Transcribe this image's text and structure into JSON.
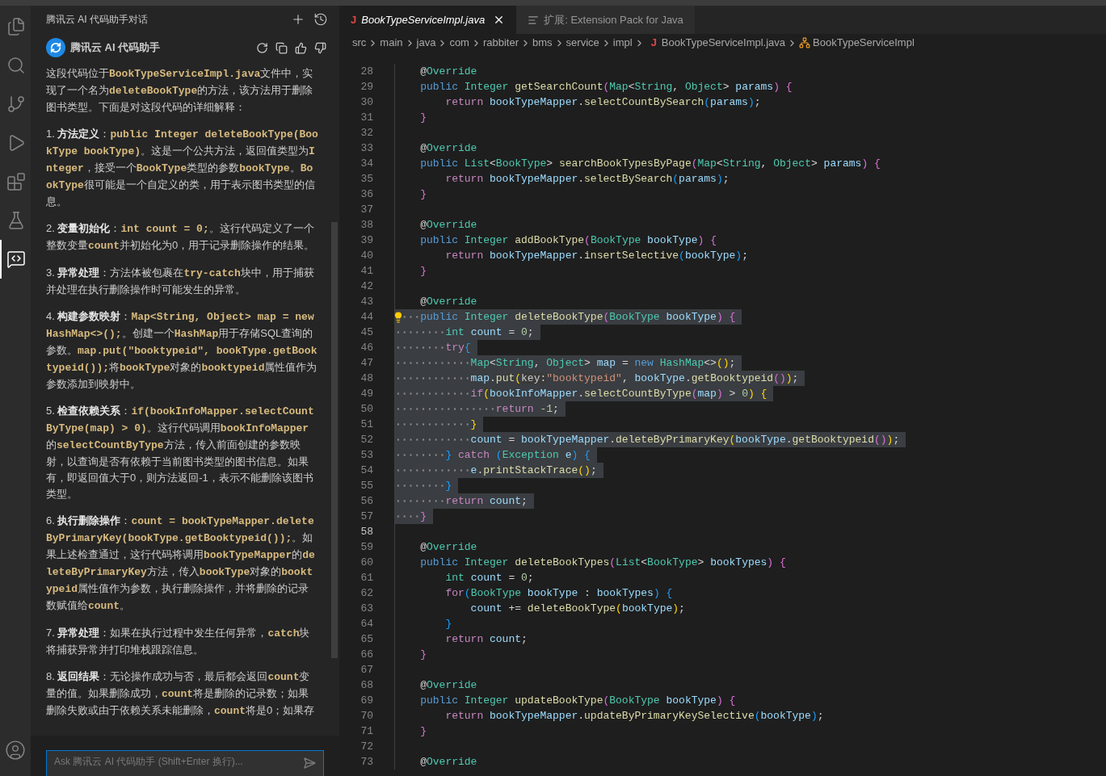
{
  "activity_bar": {
    "items": [
      {
        "kind": "files",
        "selected": false
      },
      {
        "kind": "search",
        "selected": false
      },
      {
        "kind": "source-control",
        "selected": false
      },
      {
        "kind": "run",
        "selected": false
      },
      {
        "kind": "extensions",
        "selected": false
      },
      {
        "kind": "testing",
        "selected": false
      },
      {
        "kind": "chat",
        "selected": true
      }
    ],
    "account": {
      "kind": "account"
    }
  },
  "sidebar": {
    "title": "腾讯云 AI 代码助手对话",
    "assistant": {
      "name": "腾讯云 AI 代码助手"
    },
    "paragraphs": [
      [
        {
          "kind": "text",
          "text": "这段代码位于"
        },
        {
          "kind": "code",
          "text": "BookTypeServiceImpl.java"
        },
        {
          "kind": "text",
          "text": "文件中，实现了一个名为"
        },
        {
          "kind": "code",
          "text": "deleteBookType"
        },
        {
          "kind": "text",
          "text": "的方法，该方法用于删除图书类型。下面是对这段代码的详细解释："
        }
      ],
      [
        {
          "kind": "text",
          "text": "1. "
        },
        {
          "kind": "bold",
          "text": "方法定义"
        },
        {
          "kind": "text",
          "text": "："
        },
        {
          "kind": "code",
          "text": "public Integer deleteBookType(BookType bookType)"
        },
        {
          "kind": "text",
          "text": "。这是一个公共方法，返回值类型为"
        },
        {
          "kind": "code",
          "text": "Integer"
        },
        {
          "kind": "text",
          "text": "，接受一个"
        },
        {
          "kind": "code",
          "text": "BookType"
        },
        {
          "kind": "text",
          "text": "类型的参数"
        },
        {
          "kind": "code",
          "text": "bookType"
        },
        {
          "kind": "text",
          "text": "。"
        },
        {
          "kind": "code",
          "text": "BookType"
        },
        {
          "kind": "text",
          "text": "很可能是一个自定义的类，用于表示图书类型的信息。"
        }
      ],
      [
        {
          "kind": "text",
          "text": "2. "
        },
        {
          "kind": "bold",
          "text": "变量初始化"
        },
        {
          "kind": "text",
          "text": "："
        },
        {
          "kind": "code",
          "text": "int count = 0;"
        },
        {
          "kind": "text",
          "text": "。这行代码定义了一个整数变量"
        },
        {
          "kind": "code",
          "text": "count"
        },
        {
          "kind": "text",
          "text": "并初始化为0，用于记录删除操作的结果。"
        }
      ],
      [
        {
          "kind": "text",
          "text": "3. "
        },
        {
          "kind": "bold",
          "text": "异常处理"
        },
        {
          "kind": "text",
          "text": "：方法体被包裹在"
        },
        {
          "kind": "code",
          "text": "try-catch"
        },
        {
          "kind": "text",
          "text": "块中，用于捕获并处理在执行删除操作时可能发生的异常。"
        }
      ],
      [
        {
          "kind": "text",
          "text": "4. "
        },
        {
          "kind": "bold",
          "text": "构建参数映射"
        },
        {
          "kind": "text",
          "text": "："
        },
        {
          "kind": "code",
          "text": "Map<String, Object> map = new HashMap<>();"
        },
        {
          "kind": "text",
          "text": "。创建一个"
        },
        {
          "kind": "code",
          "text": "HashMap"
        },
        {
          "kind": "text",
          "text": "用于存储SQL查询的参数。"
        },
        {
          "kind": "code",
          "text": "map.put(\"booktypeid\", bookType.getBooktypeid());"
        },
        {
          "kind": "text",
          "text": "将"
        },
        {
          "kind": "code",
          "text": "bookType"
        },
        {
          "kind": "text",
          "text": "对象的"
        },
        {
          "kind": "code",
          "text": "booktypeid"
        },
        {
          "kind": "text",
          "text": "属性值作为参数添加到映射中。"
        }
      ],
      [
        {
          "kind": "text",
          "text": "5. "
        },
        {
          "kind": "bold",
          "text": "检查依赖关系"
        },
        {
          "kind": "text",
          "text": "："
        },
        {
          "kind": "code",
          "text": "if(bookInfoMapper.selectCountByType(map) > 0)"
        },
        {
          "kind": "text",
          "text": "。这行代码调用"
        },
        {
          "kind": "code",
          "text": "bookInfoMapper"
        },
        {
          "kind": "text",
          "text": "的"
        },
        {
          "kind": "code",
          "text": "selectCountByType"
        },
        {
          "kind": "text",
          "text": "方法，传入前面创建的参数映射，以查询是否有依赖于当前图书类型的图书信息。如果有，即返回值大于0，则方法返回-1，表示不能删除该图书类型。"
        }
      ],
      [
        {
          "kind": "text",
          "text": "6. "
        },
        {
          "kind": "bold",
          "text": "执行删除操作"
        },
        {
          "kind": "text",
          "text": "："
        },
        {
          "kind": "code",
          "text": "count = bookTypeMapper.deleteByPrimaryKey(bookType.getBooktypeid());"
        },
        {
          "kind": "text",
          "text": "。如果上述检查通过，这行代码将调用"
        },
        {
          "kind": "code",
          "text": "bookTypeMapper"
        },
        {
          "kind": "text",
          "text": "的"
        },
        {
          "kind": "code",
          "text": "deleteByPrimaryKey"
        },
        {
          "kind": "text",
          "text": "方法，传入"
        },
        {
          "kind": "code",
          "text": "bookType"
        },
        {
          "kind": "text",
          "text": "对象的"
        },
        {
          "kind": "code",
          "text": "booktypeid"
        },
        {
          "kind": "text",
          "text": "属性值作为参数，执行删除操作，并将删除的记录数赋值给"
        },
        {
          "kind": "code",
          "text": "count"
        },
        {
          "kind": "text",
          "text": "。"
        }
      ],
      [
        {
          "kind": "text",
          "text": "7. "
        },
        {
          "kind": "bold",
          "text": "异常处理"
        },
        {
          "kind": "text",
          "text": "：如果在执行过程中发生任何异常，"
        },
        {
          "kind": "code",
          "text": "catch"
        },
        {
          "kind": "text",
          "text": "块将捕获异常并打印堆栈跟踪信息。"
        }
      ],
      [
        {
          "kind": "text",
          "text": "8. "
        },
        {
          "kind": "bold",
          "text": "返回结果"
        },
        {
          "kind": "text",
          "text": "：无论操作成功与否，最后都会返回"
        },
        {
          "kind": "code",
          "text": "count"
        },
        {
          "kind": "text",
          "text": "变量的值。如果删除成功，"
        },
        {
          "kind": "code",
          "text": "count"
        },
        {
          "kind": "text",
          "text": "将是删除的记录数；如果删除失败或由于依赖关系未能删除，"
        },
        {
          "kind": "code",
          "text": "count"
        },
        {
          "kind": "text",
          "text": "将是0；如果存"
        }
      ]
    ],
    "input": {
      "placeholder": "Ask 腾讯云 AI 代码助手 (Shift+Enter 换行)..."
    }
  },
  "tabs": [
    {
      "file_icon": "J",
      "label": "BookTypeServiceImpl.java",
      "selected": true,
      "kind": "file"
    },
    {
      "label": "扩展: Extension Pack for Java",
      "selected": false,
      "kind": "extension"
    }
  ],
  "breadcrumbs": [
    {
      "kind": "folder",
      "text": "src"
    },
    {
      "kind": "folder",
      "text": "main"
    },
    {
      "kind": "folder",
      "text": "java"
    },
    {
      "kind": "folder",
      "text": "com"
    },
    {
      "kind": "folder",
      "text": "rabbiter"
    },
    {
      "kind": "folder",
      "text": "bms"
    },
    {
      "kind": "folder",
      "text": "service"
    },
    {
      "kind": "folder",
      "text": "impl"
    },
    {
      "kind": "java-file",
      "file_icon": "J",
      "text": "BookTypeServiceImpl.java"
    },
    {
      "kind": "class",
      "text": "BookTypeServiceImpl"
    }
  ],
  "editor": {
    "lines": [
      {
        "number": "28",
        "selected": false,
        "current": false,
        "lightbulb": false,
        "tokens": [
          {
            "kind": "p",
            "text": "    @"
          },
          {
            "kind": "type",
            "text": "Override"
          }
        ]
      },
      {
        "number": "29",
        "selected": false,
        "current": false,
        "lightbulb": false,
        "tokens": [
          {
            "kind": "kw",
            "text": "    public "
          },
          {
            "kind": "type",
            "text": "Integer "
          },
          {
            "kind": "fn",
            "text": "getSearchCount"
          },
          {
            "kind": "b2",
            "text": "("
          },
          {
            "kind": "type",
            "text": "Map"
          },
          {
            "kind": "p",
            "text": "<"
          },
          {
            "kind": "type",
            "text": "String"
          },
          {
            "kind": "p",
            "text": ", "
          },
          {
            "kind": "type",
            "text": "Object"
          },
          {
            "kind": "p",
            "text": "> "
          },
          {
            "kind": "var",
            "text": "params"
          },
          {
            "kind": "b2",
            "text": ")"
          },
          {
            "kind": "b2",
            "text": " {"
          }
        ]
      },
      {
        "number": "30",
        "selected": false,
        "current": false,
        "lightbulb": false,
        "tokens": [
          {
            "kind": "ctl",
            "text": "        return "
          },
          {
            "kind": "var",
            "text": "bookTypeMapper"
          },
          {
            "kind": "p",
            "text": "."
          },
          {
            "kind": "fn",
            "text": "selectCountBySearch"
          },
          {
            "kind": "b3",
            "text": "("
          },
          {
            "kind": "var",
            "text": "params"
          },
          {
            "kind": "b3",
            "text": ")"
          },
          {
            "kind": "p",
            "text": ";"
          }
        ]
      },
      {
        "number": "31",
        "selected": false,
        "current": false,
        "lightbulb": false,
        "tokens": [
          {
            "kind": "b2",
            "text": "    }"
          }
        ]
      },
      {
        "number": "32",
        "selected": false,
        "current": false,
        "lightbulb": false
      },
      {
        "number": "33",
        "selected": false,
        "current": false,
        "lightbulb": false,
        "tokens": [
          {
            "kind": "p",
            "text": "    @"
          },
          {
            "kind": "type",
            "text": "Override"
          }
        ]
      },
      {
        "number": "34",
        "selected": false,
        "current": false,
        "lightbulb": false,
        "tokens": [
          {
            "kind": "kw",
            "text": "    public "
          },
          {
            "kind": "type",
            "text": "List"
          },
          {
            "kind": "p",
            "text": "<"
          },
          {
            "kind": "type",
            "text": "BookType"
          },
          {
            "kind": "p",
            "text": "> "
          },
          {
            "kind": "fn",
            "text": "searchBookTypesByPage"
          },
          {
            "kind": "b2",
            "text": "("
          },
          {
            "kind": "type",
            "text": "Map"
          },
          {
            "kind": "p",
            "text": "<"
          },
          {
            "kind": "type",
            "text": "String"
          },
          {
            "kind": "p",
            "text": ", "
          },
          {
            "kind": "type",
            "text": "Object"
          },
          {
            "kind": "p",
            "text": "> "
          },
          {
            "kind": "var",
            "text": "params"
          },
          {
            "kind": "b2",
            "text": ")"
          },
          {
            "kind": "b2",
            "text": " {"
          }
        ]
      },
      {
        "number": "35",
        "selected": false,
        "current": false,
        "lightbulb": false,
        "tokens": [
          {
            "kind": "ctl",
            "text": "        return "
          },
          {
            "kind": "var",
            "text": "bookTypeMapper"
          },
          {
            "kind": "p",
            "text": "."
          },
          {
            "kind": "fn",
            "text": "selectBySearch"
          },
          {
            "kind": "b3",
            "text": "("
          },
          {
            "kind": "var",
            "text": "params"
          },
          {
            "kind": "b3",
            "text": ")"
          },
          {
            "kind": "p",
            "text": ";"
          }
        ]
      },
      {
        "number": "36",
        "selected": false,
        "current": false,
        "lightbulb": false,
        "tokens": [
          {
            "kind": "b2",
            "text": "    }"
          }
        ]
      },
      {
        "number": "37",
        "selected": false,
        "current": false,
        "lightbulb": false
      },
      {
        "number": "38",
        "selected": false,
        "current": false,
        "lightbulb": false,
        "tokens": [
          {
            "kind": "p",
            "text": "    @"
          },
          {
            "kind": "type",
            "text": "Override"
          }
        ]
      },
      {
        "number": "39",
        "selected": false,
        "current": false,
        "lightbulb": false,
        "tokens": [
          {
            "kind": "kw",
            "text": "    public "
          },
          {
            "kind": "type",
            "text": "Integer "
          },
          {
            "kind": "fn",
            "text": "addBookType"
          },
          {
            "kind": "b2",
            "text": "("
          },
          {
            "kind": "type",
            "text": "BookType "
          },
          {
            "kind": "var",
            "text": "bookType"
          },
          {
            "kind": "b2",
            "text": ")"
          },
          {
            "kind": "b2",
            "text": " {"
          }
        ]
      },
      {
        "number": "40",
        "selected": false,
        "current": false,
        "lightbulb": false,
        "tokens": [
          {
            "kind": "ctl",
            "text": "        return "
          },
          {
            "kind": "var",
            "text": "bookTypeMapper"
          },
          {
            "kind": "p",
            "text": "."
          },
          {
            "kind": "fn",
            "text": "insertSelective"
          },
          {
            "kind": "b3",
            "text": "("
          },
          {
            "kind": "var",
            "text": "bookType"
          },
          {
            "kind": "b3",
            "text": ")"
          },
          {
            "kind": "p",
            "text": ";"
          }
        ]
      },
      {
        "number": "41",
        "selected": false,
        "current": false,
        "lightbulb": false,
        "tokens": [
          {
            "kind": "b2",
            "text": "    }"
          }
        ]
      },
      {
        "number": "42",
        "selected": false,
        "current": false,
        "lightbulb": false
      },
      {
        "number": "43",
        "selected": false,
        "current": false,
        "lightbulb": false,
        "tokens": [
          {
            "kind": "p",
            "text": "    @"
          },
          {
            "kind": "type",
            "text": "Override"
          }
        ]
      },
      {
        "number": "44",
        "selected": true,
        "current": false,
        "lightbulb": true,
        "tokens": [
          {
            "kind": "kw",
            "text": "    public "
          },
          {
            "kind": "type",
            "text": "Integer "
          },
          {
            "kind": "fn",
            "text": "deleteBookType"
          },
          {
            "kind": "b2",
            "text": "("
          },
          {
            "kind": "type",
            "text": "BookType "
          },
          {
            "kind": "var",
            "text": "bookType"
          },
          {
            "kind": "b2",
            "text": ")"
          },
          {
            "kind": "b2",
            "text": " {"
          }
        ]
      },
      {
        "number": "45",
        "selected": true,
        "current": false,
        "lightbulb": false,
        "tokens": [
          {
            "kind": "type",
            "text": "        int "
          },
          {
            "kind": "var",
            "text": "count"
          },
          {
            "kind": "p",
            "text": " = "
          },
          {
            "kind": "num",
            "text": "0"
          },
          {
            "kind": "p",
            "text": ";"
          }
        ]
      },
      {
        "number": "46",
        "selected": true,
        "current": false,
        "lightbulb": false,
        "tokens": [
          {
            "kind": "ctl",
            "text": "        try"
          },
          {
            "kind": "b3",
            "text": "{"
          }
        ]
      },
      {
        "number": "47",
        "selected": true,
        "current": false,
        "lightbulb": false,
        "tokens": [
          {
            "kind": "type",
            "text": "            Map"
          },
          {
            "kind": "p",
            "text": "<"
          },
          {
            "kind": "type",
            "text": "String"
          },
          {
            "kind": "p",
            "text": ", "
          },
          {
            "kind": "type",
            "text": "Object"
          },
          {
            "kind": "p",
            "text": "> "
          },
          {
            "kind": "var",
            "text": "map"
          },
          {
            "kind": "p",
            "text": " = "
          },
          {
            "kind": "kw",
            "text": "new "
          },
          {
            "kind": "type",
            "text": "HashMap"
          },
          {
            "kind": "p",
            "text": "<>"
          },
          {
            "kind": "b1",
            "text": "()"
          },
          {
            "kind": "p",
            "text": ";"
          }
        ]
      },
      {
        "number": "48",
        "selected": true,
        "current": false,
        "lightbulb": false,
        "tokens": [
          {
            "kind": "var",
            "text": "            map"
          },
          {
            "kind": "p",
            "text": "."
          },
          {
            "kind": "fn",
            "text": "put"
          },
          {
            "kind": "b1",
            "text": "("
          },
          {
            "kind": "hint",
            "text": "key:"
          },
          {
            "kind": "str",
            "text": "\"booktypeid\""
          },
          {
            "kind": "p",
            "text": ", "
          },
          {
            "kind": "var",
            "text": "bookType"
          },
          {
            "kind": "p",
            "text": "."
          },
          {
            "kind": "fn",
            "text": "getBooktypeid"
          },
          {
            "kind": "b2",
            "text": "()"
          },
          {
            "kind": "b1",
            "text": ")"
          },
          {
            "kind": "p",
            "text": ";"
          }
        ]
      },
      {
        "number": "49",
        "selected": true,
        "current": false,
        "lightbulb": false,
        "tokens": [
          {
            "kind": "ctl",
            "text": "            if"
          },
          {
            "kind": "b1",
            "text": "("
          },
          {
            "kind": "var",
            "text": "bookInfoMapper"
          },
          {
            "kind": "p",
            "text": "."
          },
          {
            "kind": "fn",
            "text": "selectCountByType"
          },
          {
            "kind": "b2",
            "text": "("
          },
          {
            "kind": "var",
            "text": "map"
          },
          {
            "kind": "b2",
            "text": ")"
          },
          {
            "kind": "p",
            "text": " > "
          },
          {
            "kind": "num",
            "text": "0"
          },
          {
            "kind": "b1",
            "text": ")"
          },
          {
            "kind": "b1",
            "text": " {"
          }
        ]
      },
      {
        "number": "50",
        "selected": true,
        "current": false,
        "lightbulb": false,
        "tokens": [
          {
            "kind": "ctl",
            "text": "                return "
          },
          {
            "kind": "num",
            "text": "-1"
          },
          {
            "kind": "p",
            "text": ";"
          }
        ]
      },
      {
        "number": "51",
        "selected": true,
        "current": false,
        "lightbulb": false,
        "tokens": [
          {
            "kind": "b1",
            "text": "            }"
          }
        ]
      },
      {
        "number": "52",
        "selected": true,
        "current": false,
        "lightbulb": false,
        "tokens": [
          {
            "kind": "var",
            "text": "            count"
          },
          {
            "kind": "p",
            "text": " = "
          },
          {
            "kind": "var",
            "text": "bookTypeMapper"
          },
          {
            "kind": "p",
            "text": "."
          },
          {
            "kind": "fn",
            "text": "deleteByPrimaryKey"
          },
          {
            "kind": "b1",
            "text": "("
          },
          {
            "kind": "var",
            "text": "bookType"
          },
          {
            "kind": "p",
            "text": "."
          },
          {
            "kind": "fn",
            "text": "getBooktypeid"
          },
          {
            "kind": "b2",
            "text": "()"
          },
          {
            "kind": "b1",
            "text": ")"
          },
          {
            "kind": "p",
            "text": ";"
          }
        ]
      },
      {
        "number": "53",
        "selected": true,
        "current": false,
        "lightbulb": false,
        "tokens": [
          {
            "kind": "b3",
            "text": "        }"
          },
          {
            "kind": "ctl",
            "text": " catch "
          },
          {
            "kind": "b3",
            "text": "("
          },
          {
            "kind": "type",
            "text": "Exception "
          },
          {
            "kind": "var",
            "text": "e"
          },
          {
            "kind": "b3",
            "text": ")"
          },
          {
            "kind": "b3",
            "text": " {"
          }
        ]
      },
      {
        "number": "54",
        "selected": true,
        "current": false,
        "lightbulb": false,
        "tokens": [
          {
            "kind": "var",
            "text": "            e"
          },
          {
            "kind": "p",
            "text": "."
          },
          {
            "kind": "fn",
            "text": "printStackTrace"
          },
          {
            "kind": "b1",
            "text": "()"
          },
          {
            "kind": "p",
            "text": ";"
          }
        ]
      },
      {
        "number": "55",
        "selected": true,
        "current": false,
        "lightbulb": false,
        "tokens": [
          {
            "kind": "b3",
            "text": "        }"
          }
        ]
      },
      {
        "number": "56",
        "selected": true,
        "current": false,
        "lightbulb": false,
        "tokens": [
          {
            "kind": "ctl",
            "text": "        return "
          },
          {
            "kind": "var",
            "text": "count"
          },
          {
            "kind": "p",
            "text": ";"
          }
        ]
      },
      {
        "number": "57",
        "selected": true,
        "current": false,
        "lightbulb": false,
        "tokens": [
          {
            "kind": "b2",
            "text": "    }"
          }
        ]
      },
      {
        "number": "58",
        "selected": false,
        "current": true,
        "lightbulb": false
      },
      {
        "number": "59",
        "selected": false,
        "current": false,
        "lightbulb": false,
        "tokens": [
          {
            "kind": "p",
            "text": "    @"
          },
          {
            "kind": "type",
            "text": "Override"
          }
        ]
      },
      {
        "number": "60",
        "selected": false,
        "current": false,
        "lightbulb": false,
        "tokens": [
          {
            "kind": "kw",
            "text": "    public "
          },
          {
            "kind": "type",
            "text": "Integer "
          },
          {
            "kind": "fn",
            "text": "deleteBookTypes"
          },
          {
            "kind": "b2",
            "text": "("
          },
          {
            "kind": "type",
            "text": "List"
          },
          {
            "kind": "p",
            "text": "<"
          },
          {
            "kind": "type",
            "text": "BookType"
          },
          {
            "kind": "p",
            "text": "> "
          },
          {
            "kind": "var",
            "text": "bookTypes"
          },
          {
            "kind": "b2",
            "text": ")"
          },
          {
            "kind": "b2",
            "text": " {"
          }
        ]
      },
      {
        "number": "61",
        "selected": false,
        "current": false,
        "lightbulb": false,
        "tokens": [
          {
            "kind": "type",
            "text": "        int "
          },
          {
            "kind": "var",
            "text": "count"
          },
          {
            "kind": "p",
            "text": " = "
          },
          {
            "kind": "num",
            "text": "0"
          },
          {
            "kind": "p",
            "text": ";"
          }
        ]
      },
      {
        "number": "62",
        "selected": false,
        "current": false,
        "lightbulb": false,
        "tokens": [
          {
            "kind": "ctl",
            "text": "        for"
          },
          {
            "kind": "b3",
            "text": "("
          },
          {
            "kind": "type",
            "text": "BookType "
          },
          {
            "kind": "var",
            "text": "bookType"
          },
          {
            "kind": "p",
            "text": " : "
          },
          {
            "kind": "var",
            "text": "bookTypes"
          },
          {
            "kind": "b3",
            "text": ")"
          },
          {
            "kind": "b3",
            "text": " {"
          }
        ]
      },
      {
        "number": "63",
        "selected": false,
        "current": false,
        "lightbulb": false,
        "tokens": [
          {
            "kind": "var",
            "text": "            count"
          },
          {
            "kind": "p",
            "text": " += "
          },
          {
            "kind": "fn",
            "text": "deleteBookType"
          },
          {
            "kind": "b1",
            "text": "("
          },
          {
            "kind": "var",
            "text": "bookType"
          },
          {
            "kind": "b1",
            "text": ")"
          },
          {
            "kind": "p",
            "text": ";"
          }
        ]
      },
      {
        "number": "64",
        "selected": false,
        "current": false,
        "lightbulb": false,
        "tokens": [
          {
            "kind": "b3",
            "text": "        }"
          }
        ]
      },
      {
        "number": "65",
        "selected": false,
        "current": false,
        "lightbulb": false,
        "tokens": [
          {
            "kind": "ctl",
            "text": "        return "
          },
          {
            "kind": "var",
            "text": "count"
          },
          {
            "kind": "p",
            "text": ";"
          }
        ]
      },
      {
        "number": "66",
        "selected": false,
        "current": false,
        "lightbulb": false,
        "tokens": [
          {
            "kind": "b2",
            "text": "    }"
          }
        ]
      },
      {
        "number": "67",
        "selected": false,
        "current": false,
        "lightbulb": false
      },
      {
        "number": "68",
        "selected": false,
        "current": false,
        "lightbulb": false,
        "tokens": [
          {
            "kind": "p",
            "text": "    @"
          },
          {
            "kind": "type",
            "text": "Override"
          }
        ]
      },
      {
        "number": "69",
        "selected": false,
        "current": false,
        "lightbulb": false,
        "tokens": [
          {
            "kind": "kw",
            "text": "    public "
          },
          {
            "kind": "type",
            "text": "Integer "
          },
          {
            "kind": "fn",
            "text": "updateBookType"
          },
          {
            "kind": "b2",
            "text": "("
          },
          {
            "kind": "type",
            "text": "BookType "
          },
          {
            "kind": "var",
            "text": "bookType"
          },
          {
            "kind": "b2",
            "text": ")"
          },
          {
            "kind": "b2",
            "text": " {"
          }
        ]
      },
      {
        "number": "70",
        "selected": false,
        "current": false,
        "lightbulb": false,
        "tokens": [
          {
            "kind": "ctl",
            "text": "        return "
          },
          {
            "kind": "var",
            "text": "bookTypeMapper"
          },
          {
            "kind": "p",
            "text": "."
          },
          {
            "kind": "fn",
            "text": "updateByPrimaryKeySelective"
          },
          {
            "kind": "b3",
            "text": "("
          },
          {
            "kind": "var",
            "text": "bookType"
          },
          {
            "kind": "b3",
            "text": ")"
          },
          {
            "kind": "p",
            "text": ";"
          }
        ]
      },
      {
        "number": "71",
        "selected": false,
        "current": false,
        "lightbulb": false,
        "tokens": [
          {
            "kind": "b2",
            "text": "    }"
          }
        ]
      },
      {
        "number": "72",
        "selected": false,
        "current": false,
        "lightbulb": false
      },
      {
        "number": "73",
        "selected": false,
        "current": false,
        "lightbulb": false,
        "tokens": [
          {
            "kind": "p",
            "text": "    @"
          },
          {
            "kind": "type",
            "text": "Override"
          }
        ]
      }
    ]
  }
}
